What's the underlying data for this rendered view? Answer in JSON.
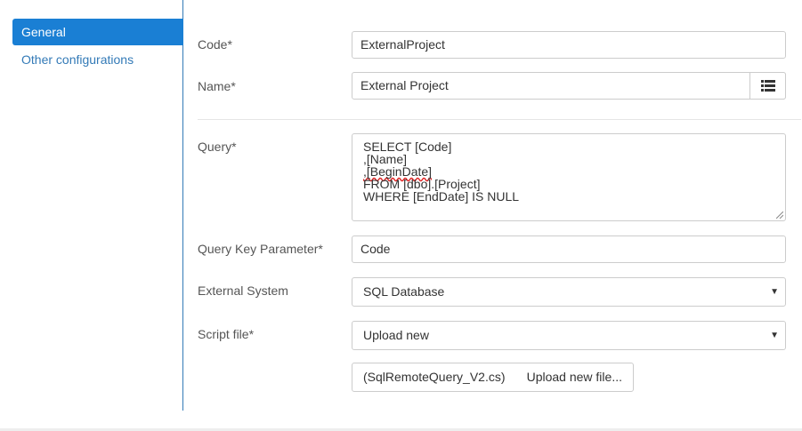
{
  "sidebar": {
    "items": [
      {
        "label": "General",
        "active": true
      },
      {
        "label": "Other configurations",
        "active": false
      }
    ]
  },
  "form": {
    "code": {
      "label": "Code*",
      "value": "ExternalProject"
    },
    "name": {
      "label": "Name*",
      "value": "External Project",
      "button_icon": "list-icon"
    },
    "query": {
      "label": "Query*",
      "lines": [
        "SELECT [Code]",
        ",[Name]",
        ",[BeginDate]",
        "FROM [dbo].[Project]",
        "WHERE [EndDate] IS NULL"
      ]
    },
    "query_key": {
      "label": "Query Key Parameter*",
      "value": "Code"
    },
    "external_system": {
      "label": "External System",
      "value": "SQL Database"
    },
    "script_file": {
      "label": "Script file*",
      "value": "Upload new",
      "upload_button": {
        "file_name": "(SqlRemoteQuery_V2.cs)",
        "label": "Upload new file...",
        "icon": "upload-icon"
      }
    }
  },
  "colors": {
    "accent": "#1a7fd4",
    "link": "#337ab7",
    "border": "#cccccc"
  }
}
